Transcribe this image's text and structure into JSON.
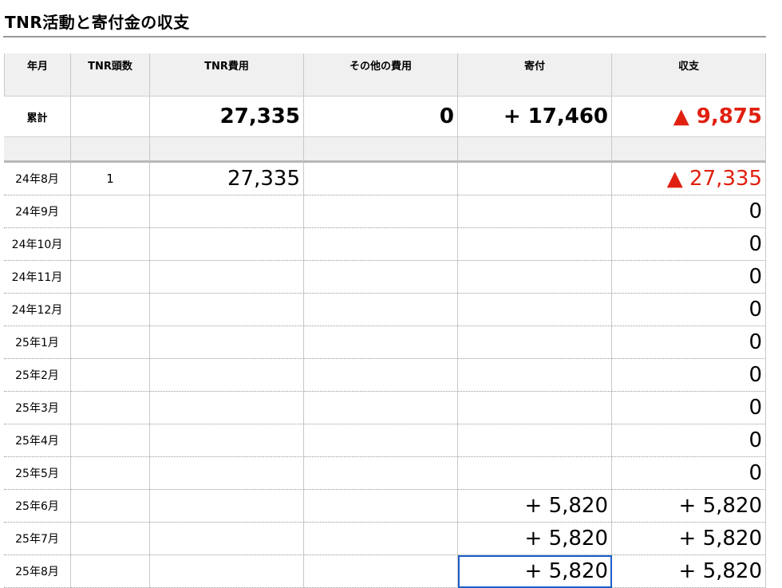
{
  "title": "TNR活動と寄付金の収支",
  "headers": [
    "年月",
    "TNR頭数",
    "TNR費用",
    "その他の費用",
    "寄付",
    "収支"
  ],
  "totals": {
    "label": "累計",
    "count": "",
    "tnr_cost": "27,335",
    "other_cost": "0",
    "donation": "+ 17,460",
    "balance": "▲ 9,875"
  },
  "rows": [
    {
      "month": "24年8月",
      "count": "1",
      "tnr_cost": "27,335",
      "other_cost": "",
      "donation": "",
      "balance": "▲ 27,335"
    },
    {
      "month": "24年9月",
      "count": "",
      "tnr_cost": "",
      "other_cost": "",
      "donation": "",
      "balance": "0"
    },
    {
      "month": "24年10月",
      "count": "",
      "tnr_cost": "",
      "other_cost": "",
      "donation": "",
      "balance": "0"
    },
    {
      "month": "24年11月",
      "count": "",
      "tnr_cost": "",
      "other_cost": "",
      "donation": "",
      "balance": "0"
    },
    {
      "month": "24年12月",
      "count": "",
      "tnr_cost": "",
      "other_cost": "",
      "donation": "",
      "balance": "0"
    },
    {
      "month": "25年1月",
      "count": "",
      "tnr_cost": "",
      "other_cost": "",
      "donation": "",
      "balance": "0"
    },
    {
      "month": "25年2月",
      "count": "",
      "tnr_cost": "",
      "other_cost": "",
      "donation": "",
      "balance": "0"
    },
    {
      "month": "25年3月",
      "count": "",
      "tnr_cost": "",
      "other_cost": "",
      "donation": "",
      "balance": "0"
    },
    {
      "month": "25年4月",
      "count": "",
      "tnr_cost": "",
      "other_cost": "",
      "donation": "",
      "balance": "0"
    },
    {
      "month": "25年5月",
      "count": "",
      "tnr_cost": "",
      "other_cost": "",
      "donation": "",
      "balance": "0"
    },
    {
      "month": "25年6月",
      "count": "",
      "tnr_cost": "",
      "other_cost": "",
      "donation": "+ 5,820",
      "balance": "+ 5,820"
    },
    {
      "month": "25年7月",
      "count": "",
      "tnr_cost": "",
      "other_cost": "",
      "donation": "+ 5,820",
      "balance": "+ 5,820"
    },
    {
      "month": "25年8月",
      "count": "",
      "tnr_cost": "",
      "other_cost": "",
      "donation": "+ 5,820",
      "balance": "+ 5,820"
    }
  ],
  "colors": {
    "negative": "#e02010",
    "header_bg": "#f0f0f0",
    "selection": "#1a5fc8"
  }
}
